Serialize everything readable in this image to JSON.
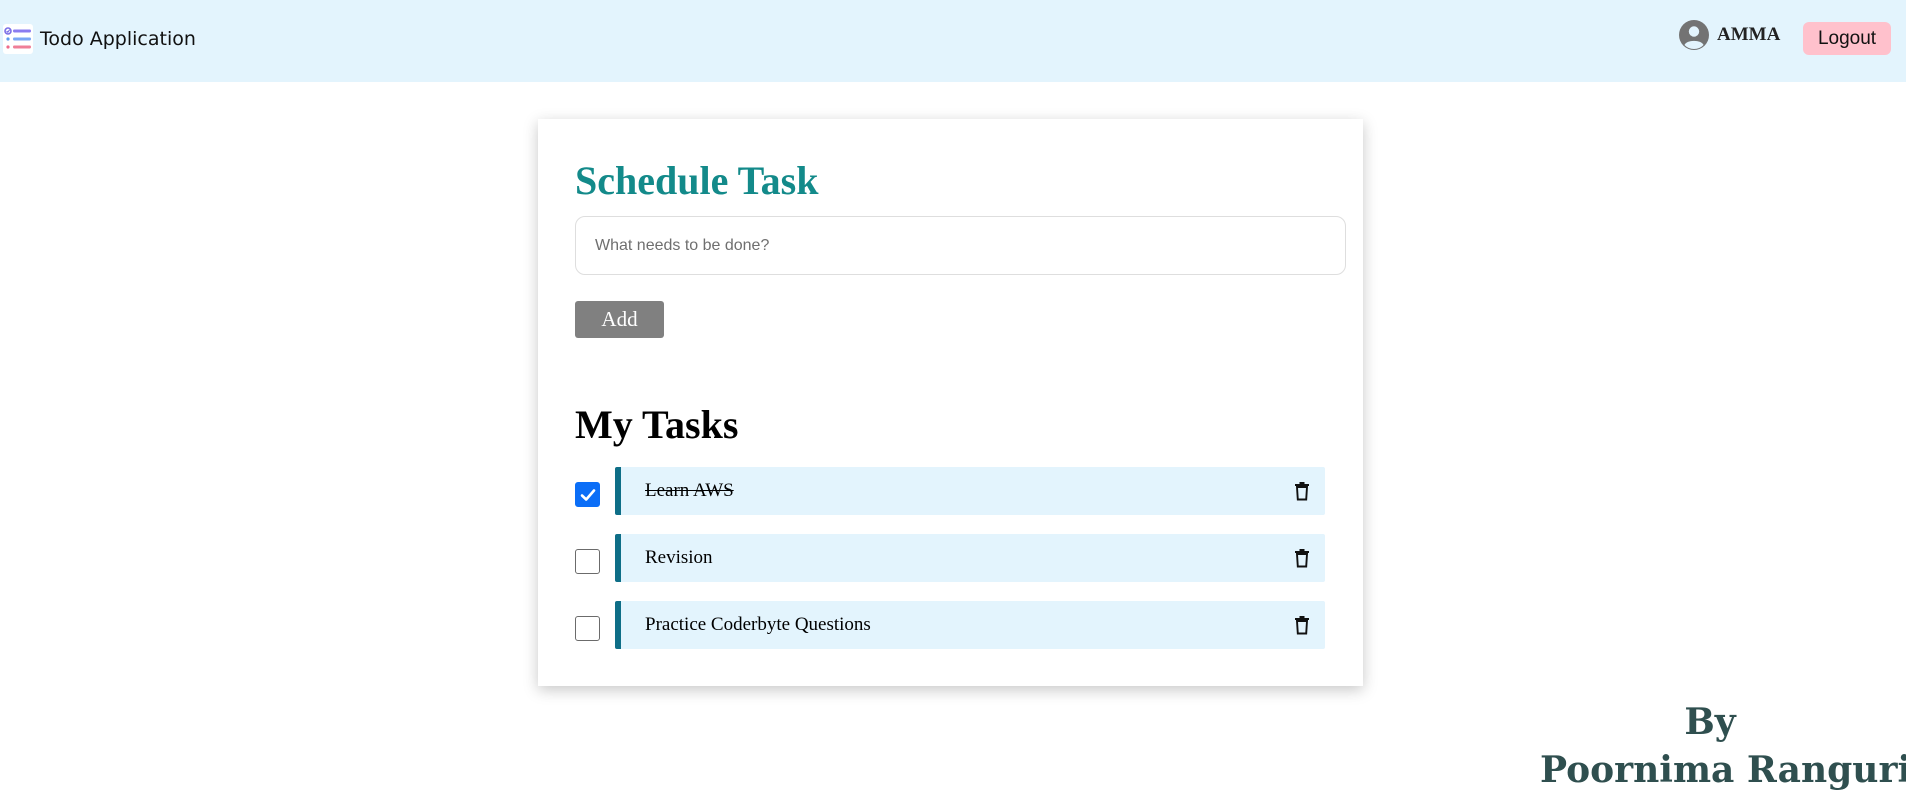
{
  "header": {
    "app_icon": "checklist-icon",
    "app_title": "Todo Application",
    "user_icon": "user-avatar-icon",
    "user_name": "AMMA",
    "logout_label": "Logout"
  },
  "schedule": {
    "title_bold": "Schedule",
    "title_rest": "Task",
    "input_placeholder": "What needs to be done?",
    "input_value": "",
    "add_label": "Add"
  },
  "tasks": {
    "title_bold": "My",
    "title_rest": "Tasks",
    "items": [
      {
        "text": "Learn AWS",
        "done": true,
        "delete_icon": "trash-icon"
      },
      {
        "text": "Revision",
        "done": false,
        "delete_icon": "trash-icon"
      },
      {
        "text": "Practice Coderbyte Questions",
        "done": false,
        "delete_icon": "trash-icon"
      }
    ]
  },
  "footer": {
    "by": "By",
    "author": "Poornima Ranguri"
  },
  "colors": {
    "header_bg": "#e3f4fd",
    "accent_teal": "#138a8a",
    "logout_bg": "#ffc1cc",
    "add_bg": "#808080",
    "task_bg": "#e3f4fd",
    "task_border": "#0e6e87",
    "checkbox_checked": "#0b6ef7",
    "author_color": "#2f4f4f"
  }
}
